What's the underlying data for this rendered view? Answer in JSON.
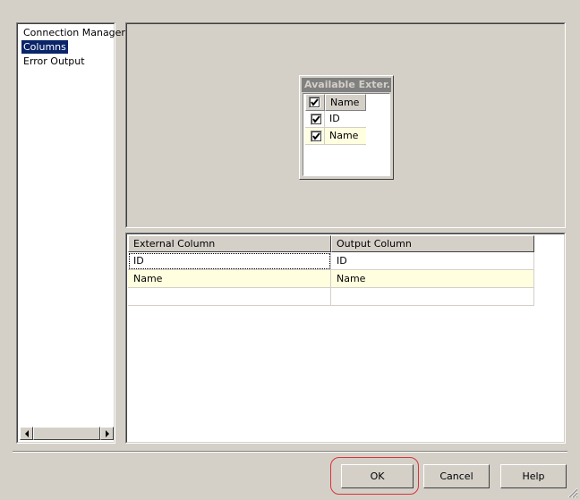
{
  "nav": {
    "items": [
      {
        "label": "Connection Manager",
        "selected": false
      },
      {
        "label": "Columns",
        "selected": true
      },
      {
        "label": "Error Output",
        "selected": false
      }
    ]
  },
  "available_columns": {
    "title": "Available Exter...",
    "header": {
      "label": "Name",
      "checked": true
    },
    "rows": [
      {
        "label": "ID",
        "checked": true
      },
      {
        "label": "Name",
        "checked": true
      }
    ]
  },
  "mapping_grid": {
    "columns": [
      "External Column",
      "Output Column"
    ],
    "rows": [
      [
        "ID",
        "ID"
      ],
      [
        "Name",
        "Name"
      ],
      [
        "",
        ""
      ]
    ]
  },
  "buttons": {
    "ok": "OK",
    "cancel": "Cancel",
    "help": "Help"
  },
  "colors": {
    "selection": "#0a246a",
    "row_highlight": "#ffffe0",
    "annotation_circle": "#d9343a"
  }
}
